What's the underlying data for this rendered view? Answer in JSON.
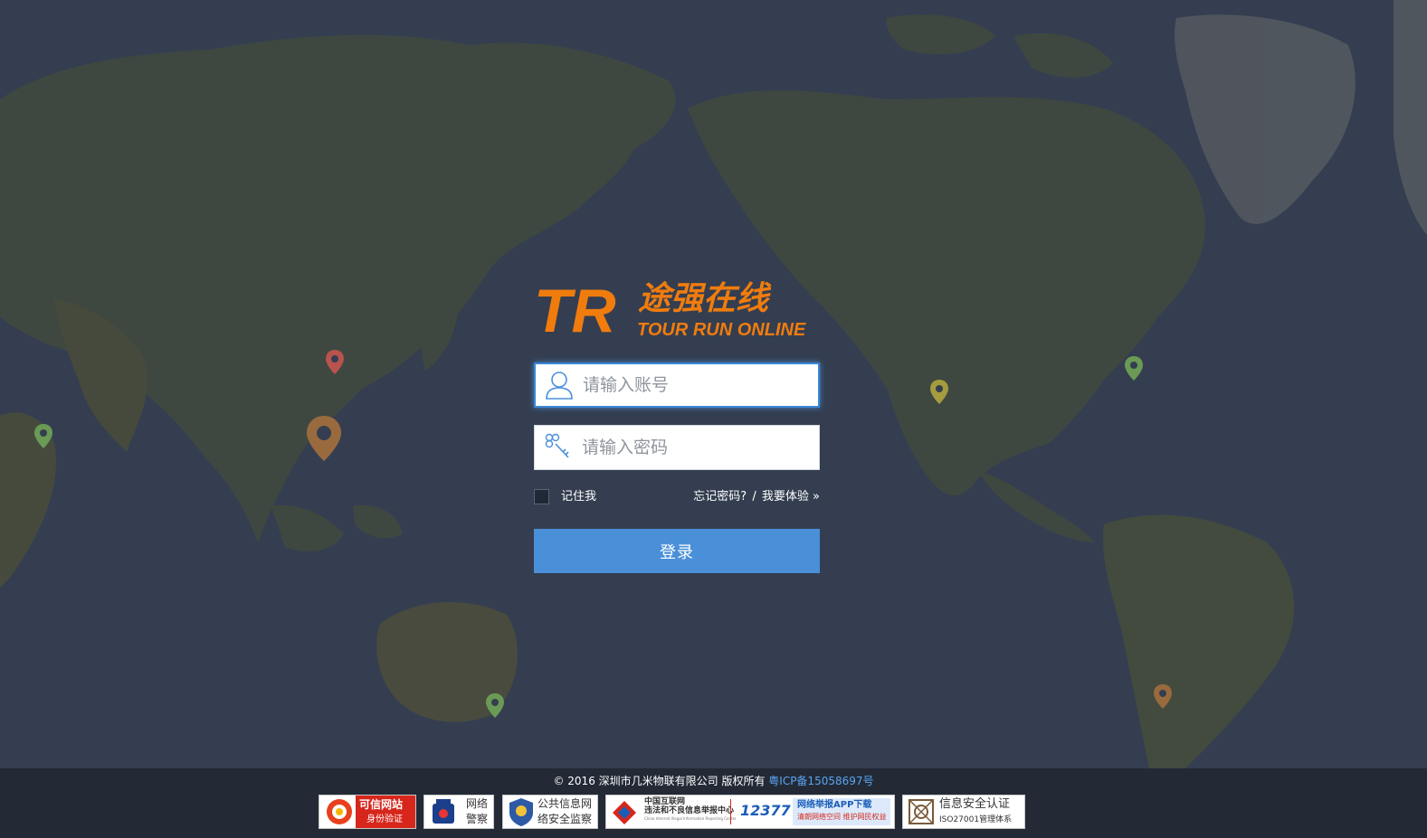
{
  "logo": {
    "mark": "TR",
    "cn_name": "途强在线",
    "en_name": "TOUR RUN ONLINE"
  },
  "form": {
    "account_placeholder": "请输入账号",
    "password_placeholder": "请输入密码",
    "remember_label": "记住我",
    "forgot_label": "忘记密码?",
    "separator": "/",
    "demo_label": "我要体验",
    "demo_arrow": "»",
    "login_label": "登录"
  },
  "footer": {
    "copyright": "© 2016 深圳市几米物联有限公司 版权所有",
    "icp": "粤ICP备15058697号",
    "badges": {
      "trusted": {
        "line1": "可信网站",
        "line2": "身份验证"
      },
      "police": {
        "line1": "网络",
        "line2": "警察"
      },
      "security": {
        "line1": "公共信息网",
        "line2": "络安全监察"
      },
      "report": {
        "center_cn1": "中国互联网",
        "center_cn2": "违法和不良信息举报中心",
        "center_en": "China Internet Illegal Information Reporting Center",
        "hotline": "12377",
        "app_line1": "网络举报APP下载",
        "app_line2": "清朗网络空间 维护网民权益"
      },
      "iso": {
        "line1": "信息安全认证",
        "line2": "ISO27001管理体系"
      }
    }
  },
  "colors": {
    "brand_orange": "#f07c0e",
    "brand_blue": "#1e6fc2",
    "login_button": "#4a90d9",
    "background": "#333c4d"
  }
}
